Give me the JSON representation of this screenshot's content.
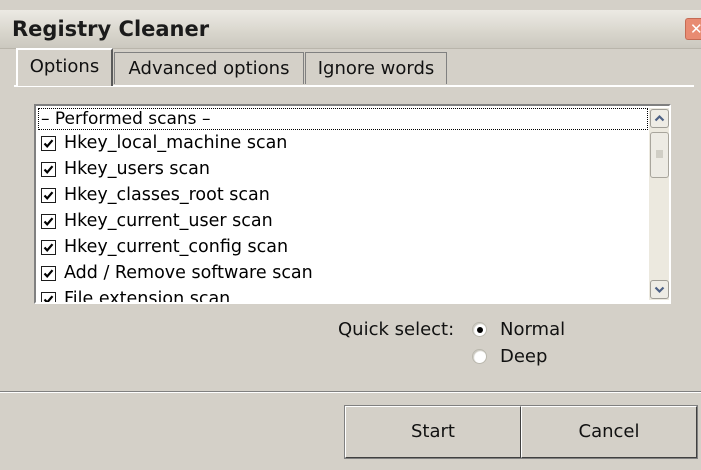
{
  "window": {
    "title": "Registry Cleaner",
    "close_glyph": "✕"
  },
  "tabs": [
    {
      "label": "Options",
      "active": true
    },
    {
      "label": "Advanced options",
      "active": false
    },
    {
      "label": "Ignore words",
      "active": false
    }
  ],
  "scans": {
    "header": "– Performed scans –",
    "items": [
      {
        "label": "Hkey_local_machine scan",
        "checked": true
      },
      {
        "label": "Hkey_users scan",
        "checked": true
      },
      {
        "label": "Hkey_classes_root scan",
        "checked": true
      },
      {
        "label": "Hkey_current_user scan",
        "checked": true
      },
      {
        "label": "Hkey_current_config scan",
        "checked": true
      },
      {
        "label": "Add / Remove software scan",
        "checked": true
      },
      {
        "label": "File extension scan",
        "checked": true
      }
    ]
  },
  "quick_select": {
    "label": "Quick select:",
    "options": [
      {
        "label": "Normal",
        "selected": true
      },
      {
        "label": "Deep",
        "selected": false
      }
    ]
  },
  "buttons": {
    "start": "Start",
    "cancel": "Cancel"
  },
  "icons": {
    "check": "check-icon",
    "scroll_up": "chevron-up-icon",
    "scroll_down": "chevron-down-icon",
    "close": "close-icon"
  },
  "colors": {
    "window_bg": "#d4d0c8",
    "close_btn": "#e88b72",
    "list_bg": "#ffffff"
  }
}
